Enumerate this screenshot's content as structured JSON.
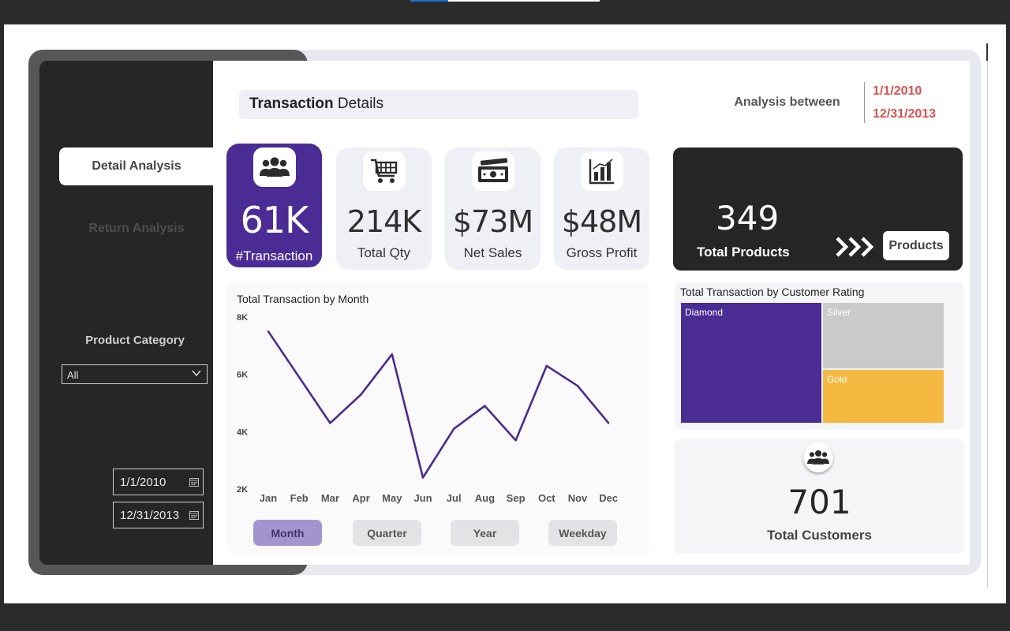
{
  "header": {
    "title_bold": "Transaction",
    "title_rest": " Details",
    "analysis_label": "Analysis between",
    "analysis_start": "1/1/2010",
    "analysis_end": "12/31/2013"
  },
  "sidebar": {
    "nav": [
      {
        "label": "Detail Analysis",
        "active": true
      },
      {
        "label": "Return Analysis",
        "active": false
      }
    ],
    "category_label": "Product Category",
    "category_value": "All",
    "date_start": "1/1/2010",
    "date_end": "12/31/2013"
  },
  "kpis": [
    {
      "value": "61K",
      "label": "#Transaction",
      "icon": "users-icon",
      "active": true
    },
    {
      "value": "214K",
      "label": "Total Qty",
      "icon": "cart-icon",
      "active": false
    },
    {
      "value": "$73M",
      "label": "Net Sales",
      "icon": "money-icon",
      "active": false
    },
    {
      "value": "$48M",
      "label": "Gross Profit",
      "icon": "bar-chart-icon",
      "active": false
    }
  ],
  "products": {
    "value": "349",
    "label": "Total Products",
    "button_label": "Products"
  },
  "customers": {
    "value": "701",
    "label": "Total Customers"
  },
  "time_buttons": [
    {
      "label": "Month",
      "active": true
    },
    {
      "label": "Quarter",
      "active": false
    },
    {
      "label": "Year",
      "active": false
    },
    {
      "label": "Weekday",
      "active": false
    }
  ],
  "colors": {
    "accent": "#4b2b94",
    "line": "#4b2b94",
    "diamond": "#4b2b94",
    "silver": "#cacaca",
    "gold": "#f5b942",
    "date_red": "#d9534f"
  },
  "chart_data": [
    {
      "type": "line",
      "title": "Total Transaction by Month",
      "categories": [
        "Jan",
        "Feb",
        "Mar",
        "Apr",
        "May",
        "Jun",
        "Jul",
        "Aug",
        "Sep",
        "Oct",
        "Nov",
        "Dec"
      ],
      "values": [
        7500,
        5900,
        4300,
        5300,
        6700,
        2400,
        4100,
        4900,
        3700,
        6300,
        5600,
        4300
      ],
      "ylim": [
        2000,
        8000
      ],
      "yticks": [
        "2K",
        "4K",
        "6K",
        "8K"
      ],
      "ytick_values": [
        2000,
        4000,
        6000,
        8000
      ],
      "xlabel": "",
      "ylabel": "",
      "grid": false
    },
    {
      "type": "treemap",
      "title": "Total Transaction by Customer Rating",
      "categories": [
        "Diamond",
        "Silver",
        "Gold"
      ],
      "values": [
        32000,
        16000,
        13000
      ]
    }
  ]
}
